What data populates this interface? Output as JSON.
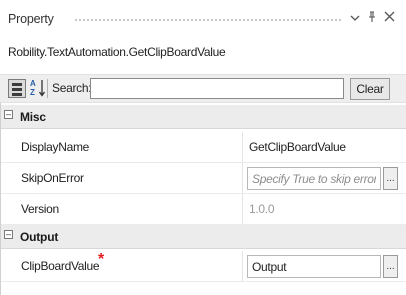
{
  "panel": {
    "title": "Property",
    "icons": {
      "dropdown": "chevron-down-icon",
      "pin": "pin-icon",
      "close": "close-icon"
    },
    "activity_name": "Robility.TextAutomation.GetClipBoardValue"
  },
  "toolbar": {
    "search_label": "Search:",
    "search_value": "",
    "clear_label": "Clear"
  },
  "categories": [
    {
      "label": "Misc",
      "toggle": "⊟",
      "properties": [
        {
          "name": "DisplayName",
          "value": "GetClipBoardValue"
        },
        {
          "name": "SkipOnError",
          "placeholder": "Specify True to skip errors d",
          "button": "..."
        },
        {
          "name": "Version",
          "value": "1.0.0"
        }
      ]
    },
    {
      "label": "Output",
      "toggle": "⊟",
      "properties": [
        {
          "name": "ClipBoardValue",
          "required_mark": "*",
          "value": "Output",
          "button": "..."
        }
      ]
    }
  ],
  "colors": {
    "required": "#e0201f",
    "category_bg": "#ececec",
    "readonly_text": "#9a9a9a"
  }
}
